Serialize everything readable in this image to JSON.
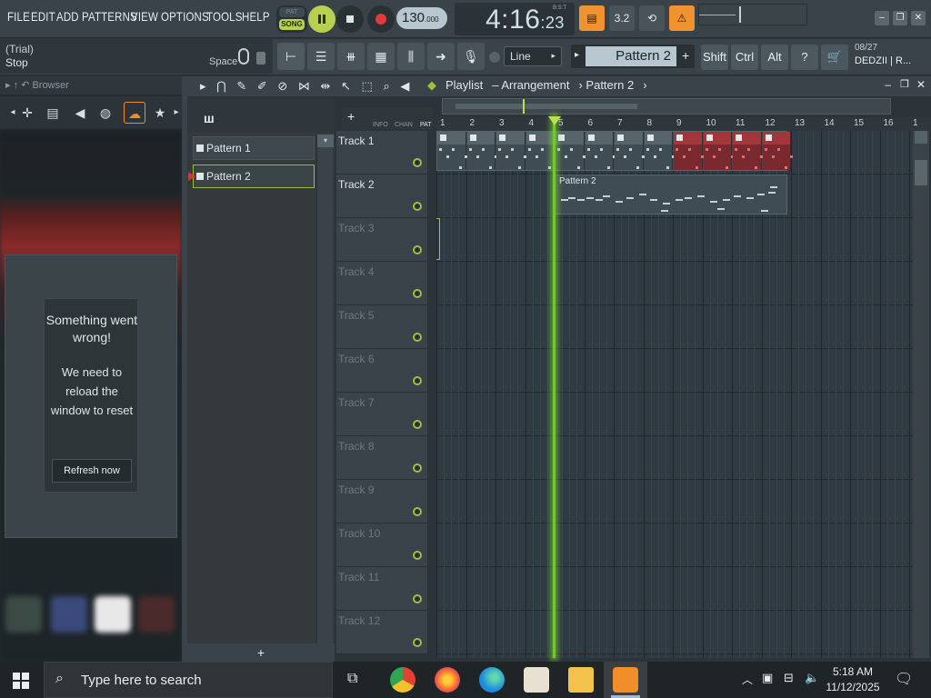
{
  "menu": [
    "FILE",
    "EDIT",
    "ADD",
    "PATTERNS",
    "VIEW",
    "OPTIONS",
    "TOOLS",
    "HELP"
  ],
  "transport": {
    "pat_label": "PAT",
    "song_label": "SONG",
    "tempo_main": "130",
    "tempo_frac": ".000",
    "time_main": "4:16",
    "time_frac": ":23",
    "time_unit": "B:S:T"
  },
  "hint": {
    "line1": "(Trial)",
    "line2": "Stop",
    "shortcut": "Space"
  },
  "toolbar2": {
    "snap_value": "Line",
    "pattern_selector": "Pattern 2",
    "shift_label": "Shift",
    "ctrl_label": "Ctrl",
    "alt_label": "Alt"
  },
  "user": {
    "date": "08/27",
    "name": "DEDZII | R..."
  },
  "browser": {
    "title": "Browser",
    "error_title": "Something went wrong!",
    "error_message": "We need to reload the window to reset",
    "refresh_button": "Refresh now"
  },
  "pattern_list": [
    {
      "label": "Pattern 1",
      "selected": false
    },
    {
      "label": "Pattern 2",
      "selected": true
    }
  ],
  "playlist": {
    "title": "Playlist",
    "view": "Arrangement",
    "pattern": "Pattern 2",
    "header_labels": [
      "INFO",
      "CHAN",
      "PAT"
    ],
    "ruler": [
      "1",
      "2",
      "3",
      "4",
      "5",
      "6",
      "7",
      "8",
      "9",
      "10",
      "11",
      "12",
      "13",
      "14",
      "15",
      "16",
      "1"
    ],
    "tracks": [
      {
        "name": "Track 1",
        "dim": false
      },
      {
        "name": "Track 2",
        "dim": false
      },
      {
        "name": "Track 3",
        "dim": true
      },
      {
        "name": "Track 4",
        "dim": true
      },
      {
        "name": "Track 5",
        "dim": true
      },
      {
        "name": "Track 6",
        "dim": true
      },
      {
        "name": "Track 7",
        "dim": true
      },
      {
        "name": "Track 8",
        "dim": true
      },
      {
        "name": "Track 9",
        "dim": true
      },
      {
        "name": "Track 10",
        "dim": true
      },
      {
        "name": "Track 11",
        "dim": true
      },
      {
        "name": "Track 12",
        "dim": true
      }
    ],
    "clip_label": "Pattern 2"
  },
  "taskbar": {
    "search_placeholder": "Type here to search",
    "time": "5:18 AM",
    "date": "11/12/2025"
  },
  "colors": {
    "accent_green": "#9bc23a",
    "playhead": "#74c734",
    "song_lime": "#b8cf4f",
    "orange": "#f0922f",
    "clip_red": "#7a2a2e"
  }
}
